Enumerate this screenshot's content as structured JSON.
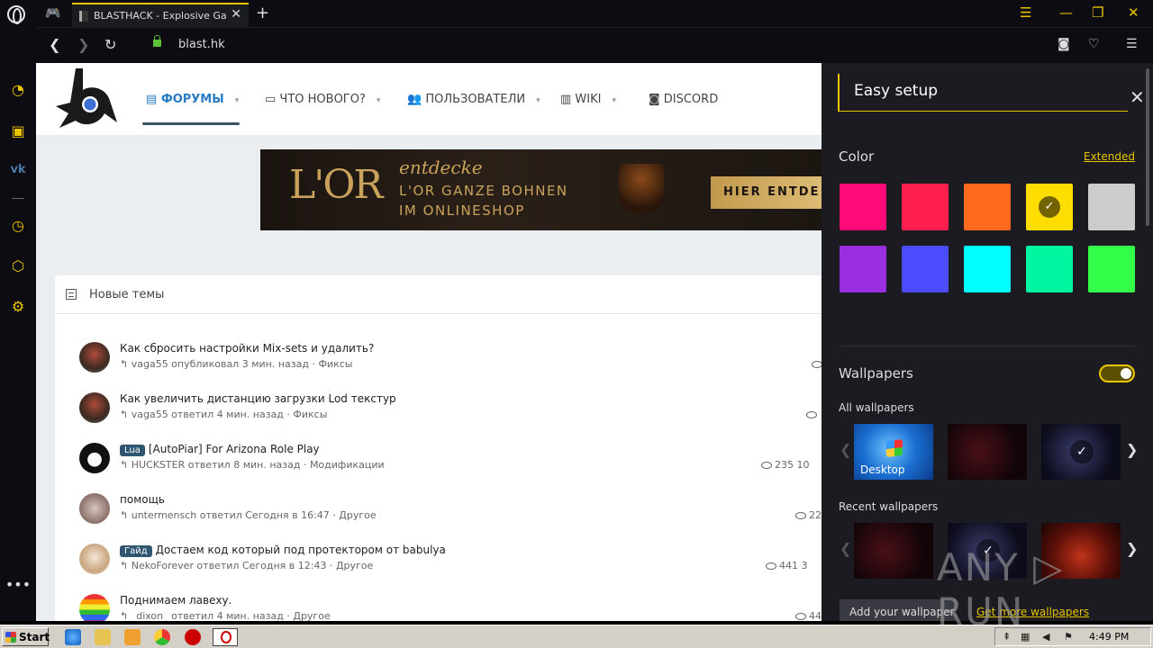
{
  "browser": {
    "tab_title": "BLASTHACK - Explosive Gamel",
    "tab_close": "✕",
    "new_tab": "+",
    "url": "blast.hk",
    "accent": "#e9c500"
  },
  "site": {
    "nav": [
      {
        "label": "ФОРУМЫ",
        "icon": "forum-icon",
        "active": true
      },
      {
        "label": "ЧТО НОВОГО?",
        "icon": "whats-new-icon"
      },
      {
        "label": "ПОЛЬЗОВАТЕЛИ",
        "icon": "users-icon"
      },
      {
        "label": "WIKI",
        "icon": "wiki-icon"
      },
      {
        "label": "DISCORD",
        "icon": "discord-icon"
      }
    ],
    "banner": {
      "logo": "L'OR",
      "line1": "entdecke",
      "line2": "L'OR GANZE BOHNEN",
      "line3": "IM ONLINESHOP",
      "cta": "HIER ENTDE"
    },
    "new_threads": {
      "title": "Новые темы",
      "items": [
        {
          "title": "Как сбросить настройки Mix-sets и удалить?",
          "prefix": "",
          "meta": "vaga55 опубликовал 3 мин. назад · Фиксы",
          "stats": ""
        },
        {
          "title": "Как увеличить дистанцию загрузки Lod текстур",
          "prefix": "",
          "meta": "vaga55 ответил 4 мин. назад · Фиксы",
          "stats": ""
        },
        {
          "title": "[AutoPiar] For Arizona Role Play",
          "prefix": "Lua",
          "meta": "HUCKSTER ответил 8 мин. назад · Модификации",
          "stats": "235  10"
        },
        {
          "title": "помощь",
          "prefix": "",
          "meta": "untermensch ответил Сегодня в 16:47 · Другое",
          "stats": "22"
        },
        {
          "title": "Достаем код который под протектором от babulya",
          "prefix": "Гайд",
          "meta": "NekoForever ответил Сегодня в 12:43 · Другое",
          "stats": "441  3"
        },
        {
          "title": "Поднимаем лавеху.",
          "prefix": "",
          "meta": "_dixon_ ответил 4 мин. назад · Другое",
          "stats": "44"
        }
      ]
    }
  },
  "easy_setup": {
    "title": "Easy setup",
    "color_label": "Color",
    "extended_link": "Extended",
    "colors": [
      "#ff0a78",
      "#ff1f4e",
      "#ff6a1f",
      "#ffdd00",
      "#cccccc",
      "#9a2ee0",
      "#4b4bff",
      "#00ffff",
      "#00f5a0",
      "#33ff4a"
    ],
    "selected_color": 3,
    "wallpapers_label": "Wallpapers",
    "all_wallpapers_label": "All wallpapers",
    "recent_wallpapers_label": "Recent wallpapers",
    "desktop_label": "Desktop",
    "check_mark": "✓",
    "add_wallpaper": "Add your wallpaper",
    "get_more": "Get more wallpapers"
  },
  "watermark": "ANY ▷ RUN",
  "taskbar": {
    "start": "Start",
    "clock": "4:49 PM"
  }
}
